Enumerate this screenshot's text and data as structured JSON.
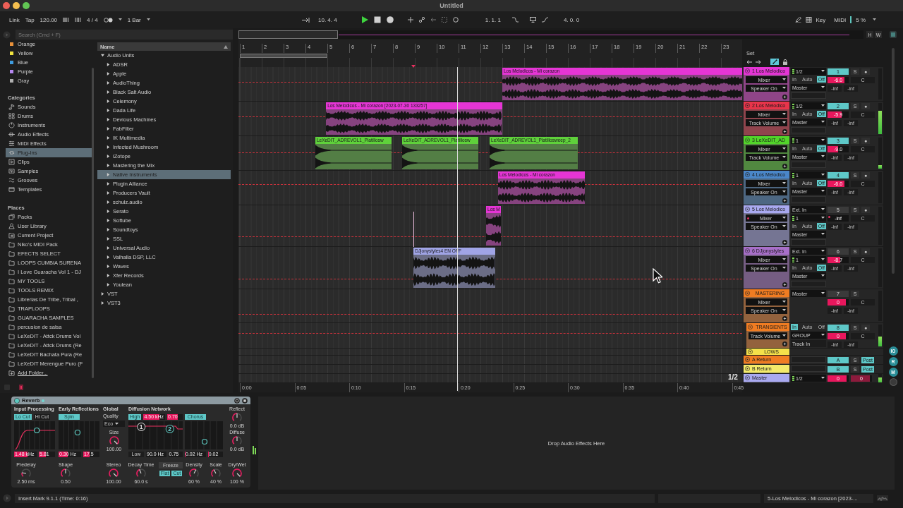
{
  "window": {
    "title": "Untitled"
  },
  "control_bar": {
    "link": "Link",
    "tap": "Tap",
    "tempo": "120.00",
    "signature": "4 / 4",
    "quantization": "1 Bar",
    "position": "10. 4. 4",
    "playing": true,
    "loop_start": "1. 1. 1",
    "loop_length": "4. 0. 0",
    "key": "Key",
    "midi": "MIDI",
    "cpu": "5 %"
  },
  "browser": {
    "search": {
      "placeholder": "Search (Cmd + F)"
    },
    "collections": [
      {
        "label": "Orange",
        "color": "#e8913a",
        "selected": false
      },
      {
        "label": "Yellow",
        "color": "#f1e43f",
        "selected": false
      },
      {
        "label": "Blue",
        "color": "#3f9de0",
        "selected": false
      },
      {
        "label": "Purple",
        "color": "#b487f0",
        "selected": false
      },
      {
        "label": "Gray",
        "color": "#b0b0b0",
        "selected": false
      }
    ],
    "categories_title": "Categories",
    "categories": [
      {
        "label": "Sounds",
        "selected": false
      },
      {
        "label": "Drums",
        "selected": false
      },
      {
        "label": "Instruments",
        "selected": false
      },
      {
        "label": "Audio Effects",
        "selected": false
      },
      {
        "label": "MIDI Effects",
        "selected": false
      },
      {
        "label": "Plug-Ins",
        "selected": true
      },
      {
        "label": "Clips",
        "selected": false
      },
      {
        "label": "Samples",
        "selected": false
      },
      {
        "label": "Grooves",
        "selected": false
      },
      {
        "label": "Templates",
        "selected": false
      }
    ],
    "places_title": "Places",
    "places": [
      {
        "label": "Packs",
        "selected": false
      },
      {
        "label": "User Library",
        "selected": false
      },
      {
        "label": "Current Project",
        "selected": false
      },
      {
        "label": "Niko's MIDI Pack",
        "selected": false
      },
      {
        "label": "EFECTS SELECT",
        "selected": false
      },
      {
        "label": "LOOPS CUMBIA SURENA",
        "selected": false
      },
      {
        "label": "I Love Guaracha Vol 1 - DJ",
        "selected": false
      },
      {
        "label": "MY TOOLS",
        "selected": false
      },
      {
        "label": "TOOLS REMIX",
        "selected": false
      },
      {
        "label": "Librerias De Tribe, Tribal ,",
        "selected": false
      },
      {
        "label": "TRAPLOOPS",
        "selected": false
      },
      {
        "label": "GUARACHA SAMPLES",
        "selected": false
      },
      {
        "label": "percusion de salsa",
        "selected": false
      },
      {
        "label": "LeXeDIT - Attck Drums Vol",
        "selected": false
      },
      {
        "label": "LeXeDIT - Attck Drums (Re",
        "selected": false
      },
      {
        "label": "LeXeDIT Bachata Pura (Re",
        "selected": false
      },
      {
        "label": "LeXeDIT Merengue Puro (F",
        "selected": false
      }
    ],
    "add_folder": "Add Folder...",
    "column_header": "Name",
    "tree": [
      {
        "label": "Audio Units",
        "expanded": true,
        "selected": false,
        "children": [
          {
            "label": "ADSR",
            "expanded": false,
            "selected": false
          },
          {
            "label": "Apple",
            "expanded": false,
            "selected": false
          },
          {
            "label": "AudioThing",
            "expanded": false,
            "selected": false
          },
          {
            "label": "Black Salt Audio",
            "expanded": false,
            "selected": false
          },
          {
            "label": "Celemony",
            "expanded": false,
            "selected": false
          },
          {
            "label": "Dada Life",
            "expanded": false,
            "selected": false
          },
          {
            "label": "Devious Machines",
            "expanded": false,
            "selected": false
          },
          {
            "label": "FabFilter",
            "expanded": false,
            "selected": false
          },
          {
            "label": "IK Multimedia",
            "expanded": false,
            "selected": false
          },
          {
            "label": "Infected Mushroom",
            "expanded": false,
            "selected": false
          },
          {
            "label": "iZotope",
            "expanded": false,
            "selected": false
          },
          {
            "label": "Mastering the Mix",
            "expanded": false,
            "selected": false
          },
          {
            "label": "Native Instruments",
            "expanded": false,
            "selected": true
          },
          {
            "label": "Plugin Alliance",
            "expanded": false,
            "selected": false
          },
          {
            "label": "Producers Vault",
            "expanded": false,
            "selected": false
          },
          {
            "label": "schulz.audio",
            "expanded": false,
            "selected": false
          },
          {
            "label": "Serato",
            "expanded": false,
            "selected": false
          },
          {
            "label": "Softube",
            "expanded": false,
            "selected": false
          },
          {
            "label": "Soundtoys",
            "expanded": false,
            "selected": false
          },
          {
            "label": "SSL",
            "expanded": false,
            "selected": false
          },
          {
            "label": "Universal Audio",
            "expanded": false,
            "selected": false
          },
          {
            "label": "Valhalla DSP, LLC",
            "expanded": false,
            "selected": false
          },
          {
            "label": "Waves",
            "expanded": false,
            "selected": false
          },
          {
            "label": "Xfer Records",
            "expanded": false,
            "selected": false
          },
          {
            "label": "Youlean",
            "expanded": false,
            "selected": false
          }
        ]
      },
      {
        "label": "VST",
        "expanded": false,
        "selected": false
      },
      {
        "label": "VST3",
        "expanded": false,
        "selected": false
      }
    ]
  },
  "arrangement": {
    "overview_buttons": [
      "H",
      "W"
    ],
    "bar_numbers": [
      "1",
      "2",
      "3",
      "4",
      "5",
      "6",
      "7",
      "8",
      "9",
      "10",
      "11",
      "12",
      "13",
      "14",
      "15",
      "16",
      "17",
      "18",
      "19",
      "20",
      "21",
      "22",
      "23"
    ],
    "set_label": "Set",
    "automation_arm": true,
    "page": "1/2",
    "time_labels": [
      "0:00",
      "0:05",
      "0:10",
      "0:15",
      "0:20",
      "0:25",
      "0:30",
      "0:35",
      "0:40",
      "0:45"
    ],
    "tracks": [
      {
        "kind": "audio",
        "name": "1 Los Melodico",
        "color": "#e535d5",
        "expanded": true,
        "automated": false,
        "device": "Mixer",
        "parameter": "Speaker On",
        "io": [
          {
            "kind": "input",
            "label": "1/2"
          },
          {
            "kind": "monitor",
            "options": [
              {
                "label": "In",
                "selected": false
              },
              {
                "label": "Auto",
                "selected": false
              },
              {
                "label": "Off",
                "selected": true
              }
            ]
          },
          {
            "kind": "output",
            "label": "Master"
          },
          {
            "kind": "slot"
          }
        ],
        "mixer": {
          "number": {
            "label": "1",
            "active": true
          },
          "solo": "S",
          "arm": "●",
          "volume": {
            "value": "-6.0",
            "level": 0.8
          },
          "pan": "C",
          "peaks": [
            "-inf",
            "-inf"
          ]
        },
        "meter": {
          "level": 0
        },
        "clips": [
          {
            "name": "Los Melodicos - Mi corazon",
            "color": "#e535d5"
          }
        ]
      },
      {
        "kind": "audio",
        "name": "2 Los Melodico",
        "color": "#e8344a",
        "expanded": true,
        "automated": false,
        "device": "Mixer",
        "parameter": "Track Volume",
        "io": [
          {
            "kind": "input",
            "label": "1/2"
          },
          {
            "kind": "monitor",
            "options": [
              {
                "label": "In",
                "selected": false
              },
              {
                "label": "Auto",
                "selected": false
              },
              {
                "label": "Off",
                "selected": true
              }
            ]
          },
          {
            "kind": "output",
            "label": "Master"
          },
          {
            "kind": "slot"
          }
        ],
        "mixer": {
          "number": {
            "label": "2",
            "active": true
          },
          "solo": "S",
          "arm": "●",
          "volume": {
            "value": "-5.9",
            "level": 0.66
          },
          "pan": "C",
          "peaks": [
            "-inf",
            "-inf"
          ]
        },
        "meter": {
          "level": 0.75
        },
        "clips": [
          {
            "name": "Los Melodicos - Mi corazon [2023-07-30 133257]",
            "color": "#e535d5"
          }
        ]
      },
      {
        "kind": "audio",
        "name": "3 LeXeDIT_AD",
        "color": "#52d52a",
        "expanded": true,
        "automated": false,
        "device": "Mixer",
        "parameter": "Track Volume",
        "io": [
          {
            "kind": "input",
            "label": "1"
          },
          {
            "kind": "monitor",
            "options": [
              {
                "label": "In",
                "selected": false
              },
              {
                "label": "Auto",
                "selected": false
              },
              {
                "label": "Off",
                "selected": true
              }
            ]
          },
          {
            "kind": "output",
            "label": "Master"
          },
          {
            "kind": "slot"
          }
        ],
        "mixer": {
          "number": {
            "label": "3",
            "active": true
          },
          "solo": "S",
          "arm": "●",
          "volume": {
            "value": "-9.0",
            "level": 0.5
          },
          "pan": "C",
          "peaks": [
            "-inf",
            "-inf"
          ]
        },
        "meter": {
          "level": 0.12
        },
        "clips": [
          {
            "name": "LeXeDIT_ADREVOL1_Platillosw",
            "color": "#5fd13b"
          },
          {
            "name": "LeXeDIT_ADREVOL1_Platillosw",
            "color": "#5fd13b"
          },
          {
            "name": "LeXeDIT_ADREVOL1_Platillosweep_2",
            "color": "#5fd13b"
          }
        ]
      },
      {
        "kind": "audio",
        "name": "4 Los Melodico",
        "color": "#4a86c8",
        "expanded": true,
        "automated": false,
        "device": "Mixer",
        "parameter": "Speaker On",
        "io": [
          {
            "kind": "input",
            "label": "1"
          },
          {
            "kind": "monitor",
            "options": [
              {
                "label": "In",
                "selected": false
              },
              {
                "label": "Auto",
                "selected": false
              },
              {
                "label": "Off",
                "selected": true
              }
            ]
          },
          {
            "kind": "output",
            "label": "Master"
          },
          {
            "kind": "slot"
          }
        ],
        "mixer": {
          "number": {
            "label": "4",
            "active": true
          },
          "solo": "S",
          "arm": "●",
          "volume": {
            "value": "-6.0",
            "level": 0.8
          },
          "pan": "C",
          "peaks": [
            "-inf",
            "-inf"
          ]
        },
        "meter": {
          "level": 0
        },
        "clips": [
          {
            "name": "Los Melodicos - Mi corazon",
            "color": "#e535d5"
          }
        ]
      },
      {
        "kind": "audio",
        "name": "5 Los Melodico",
        "color": "#a9a9f0",
        "expanded": true,
        "automated": true,
        "device": "Mixer",
        "parameter": "Speaker On",
        "io": [
          {
            "kind": "input_type",
            "label": "Ext. In"
          },
          {
            "kind": "input",
            "label": "1"
          },
          {
            "kind": "monitor",
            "options": [
              {
                "label": "In",
                "selected": false
              },
              {
                "label": "Auto",
                "selected": false
              },
              {
                "label": "Off",
                "selected": true
              }
            ]
          },
          {
            "kind": "output",
            "label": "Master"
          },
          {
            "kind": "slot"
          }
        ],
        "mixer": {
          "number": {
            "label": "5",
            "active": false
          },
          "solo": "S",
          "arm": "●",
          "volume": {
            "value": "-inf"
          },
          "pan": "C",
          "peaks": [
            "-inf",
            "-inf"
          ]
        },
        "meter": {
          "level": 0
        },
        "clips": [
          {
            "name": "Los M",
            "color": "#e535d5"
          }
        ]
      },
      {
        "kind": "audio",
        "name": "6 DJjonystyles",
        "color": "#a86fc9",
        "expanded": true,
        "automated": false,
        "device": "Mixer",
        "parameter": "Speaker On",
        "io": [
          {
            "kind": "input_type",
            "label": "Ext. In"
          },
          {
            "kind": "input",
            "label": "1"
          },
          {
            "kind": "monitor",
            "options": [
              {
                "label": "In",
                "selected": false
              },
              {
                "label": "Auto",
                "selected": false
              },
              {
                "label": "Off",
                "selected": true
              }
            ]
          },
          {
            "kind": "output",
            "label": "Master"
          },
          {
            "kind": "slot"
          }
        ],
        "mixer": {
          "number": {
            "label": "6",
            "active": false
          },
          "solo": "S",
          "arm": "●",
          "volume": {
            "value": "-8.7",
            "level": 0.6
          },
          "pan": "C",
          "peaks": [
            "-inf",
            "-inf"
          ]
        },
        "meter": {
          "level": 0
        },
        "clips": [
          {
            "name": "DJjonystyles4 EN OFF",
            "color": "#a0a4e6"
          }
        ]
      },
      {
        "kind": "group",
        "name": "MASTERING",
        "color": "#f07c22",
        "expanded": true,
        "automated": false,
        "device": "Mixer",
        "parameter": "Speaker On",
        "io": [
          {
            "kind": "output",
            "label": "Master"
          }
        ],
        "mixer": {
          "number": {
            "label": "7",
            "active": false
          },
          "solo": "S",
          "volume": {
            "value": "0",
            "level": 0.85
          },
          "pan": "C",
          "peaks": [
            "-inf",
            "-inf"
          ]
        },
        "meter": {
          "level": 0
        },
        "children": [
          {
            "kind": "group",
            "name": "TRANSIENTS",
            "color": "#f07c22",
            "expanded": true,
            "parameter": "Track Volume",
            "io": [
              {
                "kind": "monitor",
                "options": [
                  {
                    "label": "In",
                    "selected": true
                  },
                  {
                    "label": "Auto",
                    "selected": false
                  },
                  {
                    "label": "Off",
                    "selected": false
                  }
                ]
              },
              {
                "kind": "output",
                "label": "GROUP"
              },
              {
                "kind": "field",
                "label": "Track In"
              }
            ],
            "mixer": {
              "number": {
                "label": "8",
                "active": true
              },
              "solo": "S",
              "arm": "●",
              "volume": {
                "value": "0",
                "level": 0.85
              },
              "pan": "C",
              "peaks": [
                "-inf",
                "-inf"
              ]
            },
            "meter": {
              "level": 0.45
            }
          },
          {
            "kind": "group",
            "name": "LOWS",
            "color": "#f4e04a",
            "expanded": true
          }
        ]
      }
    ],
    "returns": [
      {
        "name": "A Return",
        "color": "#f07c22",
        "expanded": false,
        "io": [
          {
            "kind": "slot"
          }
        ],
        "mixer": {
          "number": {
            "label": "A",
            "active": true
          },
          "solo": "S",
          "post": {
            "label": "Post",
            "on": true
          }
        }
      },
      {
        "name": "B Return",
        "color": "#f4ea6a",
        "expanded": false,
        "io": [
          {
            "kind": "slot"
          }
        ],
        "mixer": {
          "number": {
            "label": "B",
            "active": true
          },
          "solo": "S",
          "post": {
            "label": "Post",
            "on": true
          }
        }
      }
    ],
    "master": {
      "name": "Master",
      "color": "#a9a9f0",
      "expanded": false,
      "io": [
        {
          "kind": "input",
          "label": "1/2"
        }
      ],
      "mixer": {
        "volume": {
          "value": "0",
          "level": 0.9
        },
        "cue": {
          "value": "0",
          "level": 0.9
        }
      },
      "meter": {
        "level": 0.6
      }
    },
    "view_toggles": [
      {
        "label": "IO",
        "on": true
      },
      {
        "label": "R",
        "on": true
      },
      {
        "label": "M",
        "on": true
      }
    ]
  },
  "device_view": {
    "device": {
      "name": "Reverb",
      "on": true,
      "input_processing": {
        "title": "Input Processing",
        "lo_cut": {
          "label": "Lo Cut",
          "on": true
        },
        "hi_cut": {
          "label": "Hi Cut",
          "on": false
        },
        "values": [
          {
            "value": "1.48 kHz",
            "level": 0.6
          },
          {
            "value": "5.81",
            "level": 0.45
          }
        ]
      },
      "early_reflections": {
        "title": "Early Reflections",
        "spin": {
          "label": "Spin",
          "on": true
        },
        "values": [
          {
            "value": "0.30 Hz",
            "level": 0.4
          },
          {
            "value": "17.5",
            "level": 0.4
          }
        ]
      },
      "global": {
        "title": "Global",
        "quality_label": "Quality",
        "quality": "Eco",
        "size": {
          "label": "Size",
          "value": "100.00",
          "level": 1
        }
      },
      "diffusion": {
        "title": "Diffusion Network",
        "high": {
          "label": "High",
          "on": true
        },
        "high_values": [
          {
            "value": "4.50 kHz",
            "level": 0.75
          },
          {
            "value": "0.70",
            "level": 0.7
          }
        ],
        "handles": [
          "1",
          "2"
        ],
        "low": {
          "label": "Low",
          "on": false
        },
        "low_values": [
          {
            "value": "90.0 Hz"
          },
          {
            "value": "0.75"
          }
        ]
      },
      "chorus": {
        "label": "Chorus",
        "on": true,
        "values": [
          {
            "value": "0.02 Hz",
            "level": 0.05
          },
          {
            "value": "0.02",
            "level": 0.05
          }
        ]
      },
      "reflect": {
        "label": "Reflect",
        "value": "0.0 dB",
        "level": 0.5
      },
      "diffuse": {
        "label": "Diffuse",
        "value": "0.0 dB",
        "level": 0.5
      },
      "knobs": [
        {
          "label": "Predelay",
          "value": "2.50 ms",
          "level": 0.2
        },
        {
          "label": "Shape",
          "value": "0.50",
          "level": 0.5
        },
        {
          "label": "Stereo",
          "value": "100.00",
          "level": 1
        },
        {
          "label": "Decay Time",
          "value": "60.0 s",
          "level": 0.42
        },
        {
          "label": "Density",
          "value": "60 %",
          "level": 0.6
        },
        {
          "label": "Scale",
          "value": "40 %",
          "level": 0.4
        },
        {
          "label": "Dry/Wet",
          "value": "100 %",
          "level": 1
        }
      ],
      "freeze": {
        "label": "Freeze",
        "on": false
      },
      "flat": {
        "label": "Flat",
        "on": true
      },
      "cut": {
        "label": "Cut",
        "on": true
      }
    },
    "drop_hint": "Drop Audio Effects Here"
  },
  "status_bar": {
    "message": "Insert Mark 9.1.1 (Time: 0:16)",
    "selection": "5-Los Melodicos - Mi corazon [2023-..."
  }
}
